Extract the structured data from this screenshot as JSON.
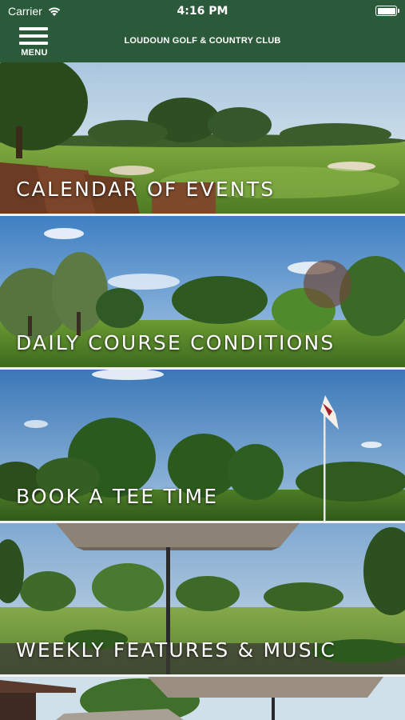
{
  "status_bar": {
    "carrier": "Carrier",
    "time": "4:16 PM",
    "wifi_icon": "wifi-icon",
    "battery_icon": "battery-icon"
  },
  "nav": {
    "menu_label": "MENU",
    "menu_icon": "hamburger-icon",
    "title": "LOUDOUN GOLF & COUNTRY CLUB",
    "brand_color": "#2b5a3a"
  },
  "tiles": [
    {
      "label": "CALENDAR OF EVENTS"
    },
    {
      "label": "DAILY COURSE CONDITIONS"
    },
    {
      "label": "BOOK A TEE TIME"
    },
    {
      "label": "WEEKLY FEATURES & MUSIC"
    },
    {
      "label": ""
    }
  ]
}
